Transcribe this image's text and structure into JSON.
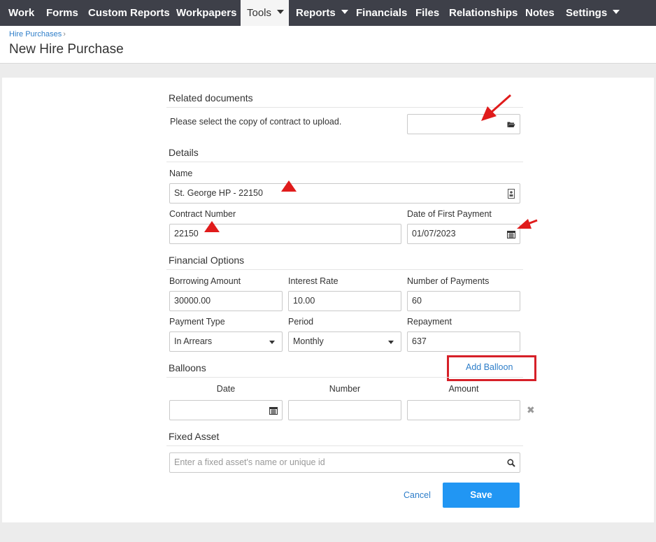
{
  "nav": {
    "items": [
      {
        "label": "Work"
      },
      {
        "label": "Forms"
      },
      {
        "label": "Custom Reports"
      },
      {
        "label": "Workpapers"
      },
      {
        "label": "Tools"
      },
      {
        "label": "Reports"
      },
      {
        "label": "Financials"
      },
      {
        "label": "Files"
      },
      {
        "label": "Relationships"
      },
      {
        "label": "Notes"
      },
      {
        "label": "Settings"
      }
    ]
  },
  "breadcrumb": {
    "label": "Hire Purchases",
    "separator": "›"
  },
  "page": {
    "title": "New Hire Purchase"
  },
  "related_documents": {
    "title": "Related documents",
    "instruction": "Please select the copy of contract to upload.",
    "file_value": ""
  },
  "details": {
    "title": "Details",
    "name_label": "Name",
    "name_value": "St. George HP - 22150",
    "contract_label": "Contract Number",
    "contract_value": "22150",
    "first_payment_label": "Date of First Payment",
    "first_payment_value": "01/07/2023"
  },
  "financial": {
    "title": "Financial Options",
    "borrowing_label": "Borrowing Amount",
    "borrowing_value": "30000.00",
    "interest_label": "Interest Rate",
    "interest_value": "10.00",
    "payments_label": "Number of Payments",
    "payments_value": "60",
    "payment_type_label": "Payment Type",
    "payment_type_value": "In Arrears",
    "period_label": "Period",
    "period_value": "Monthly",
    "repayment_label": "Repayment",
    "repayment_value": "637"
  },
  "balloons": {
    "title": "Balloons",
    "add_label": "Add Balloon",
    "col_date": "Date",
    "col_number": "Number",
    "col_amount": "Amount",
    "row": {
      "date": "",
      "number": "",
      "amount": "",
      "remove_label": "✖"
    }
  },
  "fixed_asset": {
    "title": "Fixed Asset",
    "placeholder": "Enter a fixed asset's name or unique id"
  },
  "actions": {
    "cancel_label": "Cancel",
    "save_label": "Save"
  },
  "colors": {
    "nav_bg": "#3e4049",
    "accent": "#2196f3",
    "link": "#2e7ec9",
    "annotation_red": "#e01b1b"
  },
  "icons": [
    "nav-caret-icon",
    "folder-open-icon",
    "contact-card-icon",
    "calendar-icon",
    "search-icon",
    "remove-icon",
    "annotation-arrow"
  ]
}
